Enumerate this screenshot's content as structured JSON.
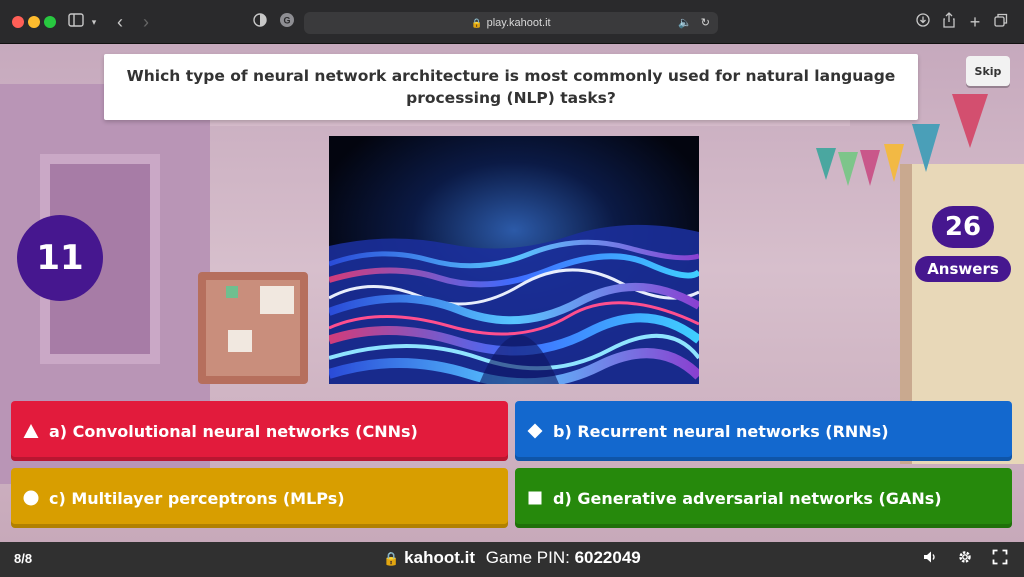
{
  "browser": {
    "url": "play.kahoot.it",
    "icons": [
      "sidebar-icon",
      "chevron-down-icon",
      "back-icon",
      "forward-icon",
      "shield-icon",
      "grammarly-icon",
      "audio-icon",
      "reload-icon",
      "download-icon",
      "share-icon",
      "new-tab-icon",
      "tabs-icon"
    ]
  },
  "game": {
    "question": "Which type of neural network architecture is most commonly used for natural language processing (NLP) tasks?",
    "skip_label": "Skip",
    "timer": "11",
    "answers_count": "26",
    "answers_label": "Answers",
    "options": [
      {
        "label": "a) Convolutional neural networks (CNNs)",
        "shape": "triangle",
        "color": "#e21b3c"
      },
      {
        "label": "b) Recurrent neural networks (RNNs)",
        "shape": "diamond",
        "color": "#1368ce"
      },
      {
        "label": "c) Multilayer perceptrons (MLPs)",
        "shape": "circle",
        "color": "#d89e00"
      },
      {
        "label": "d) Generative adversarial networks (GANs)",
        "shape": "square",
        "color": "#26890c"
      }
    ]
  },
  "footer": {
    "progress": "8/8",
    "domain": "kahoot.it",
    "pin_label": "Game PIN:",
    "pin": "6022049",
    "icons": [
      "lock-icon",
      "volume-icon",
      "settings-icon",
      "fullscreen-icon"
    ]
  },
  "colors": {
    "kahoot_purple": "#46178f",
    "footer_bg": "#303030"
  }
}
